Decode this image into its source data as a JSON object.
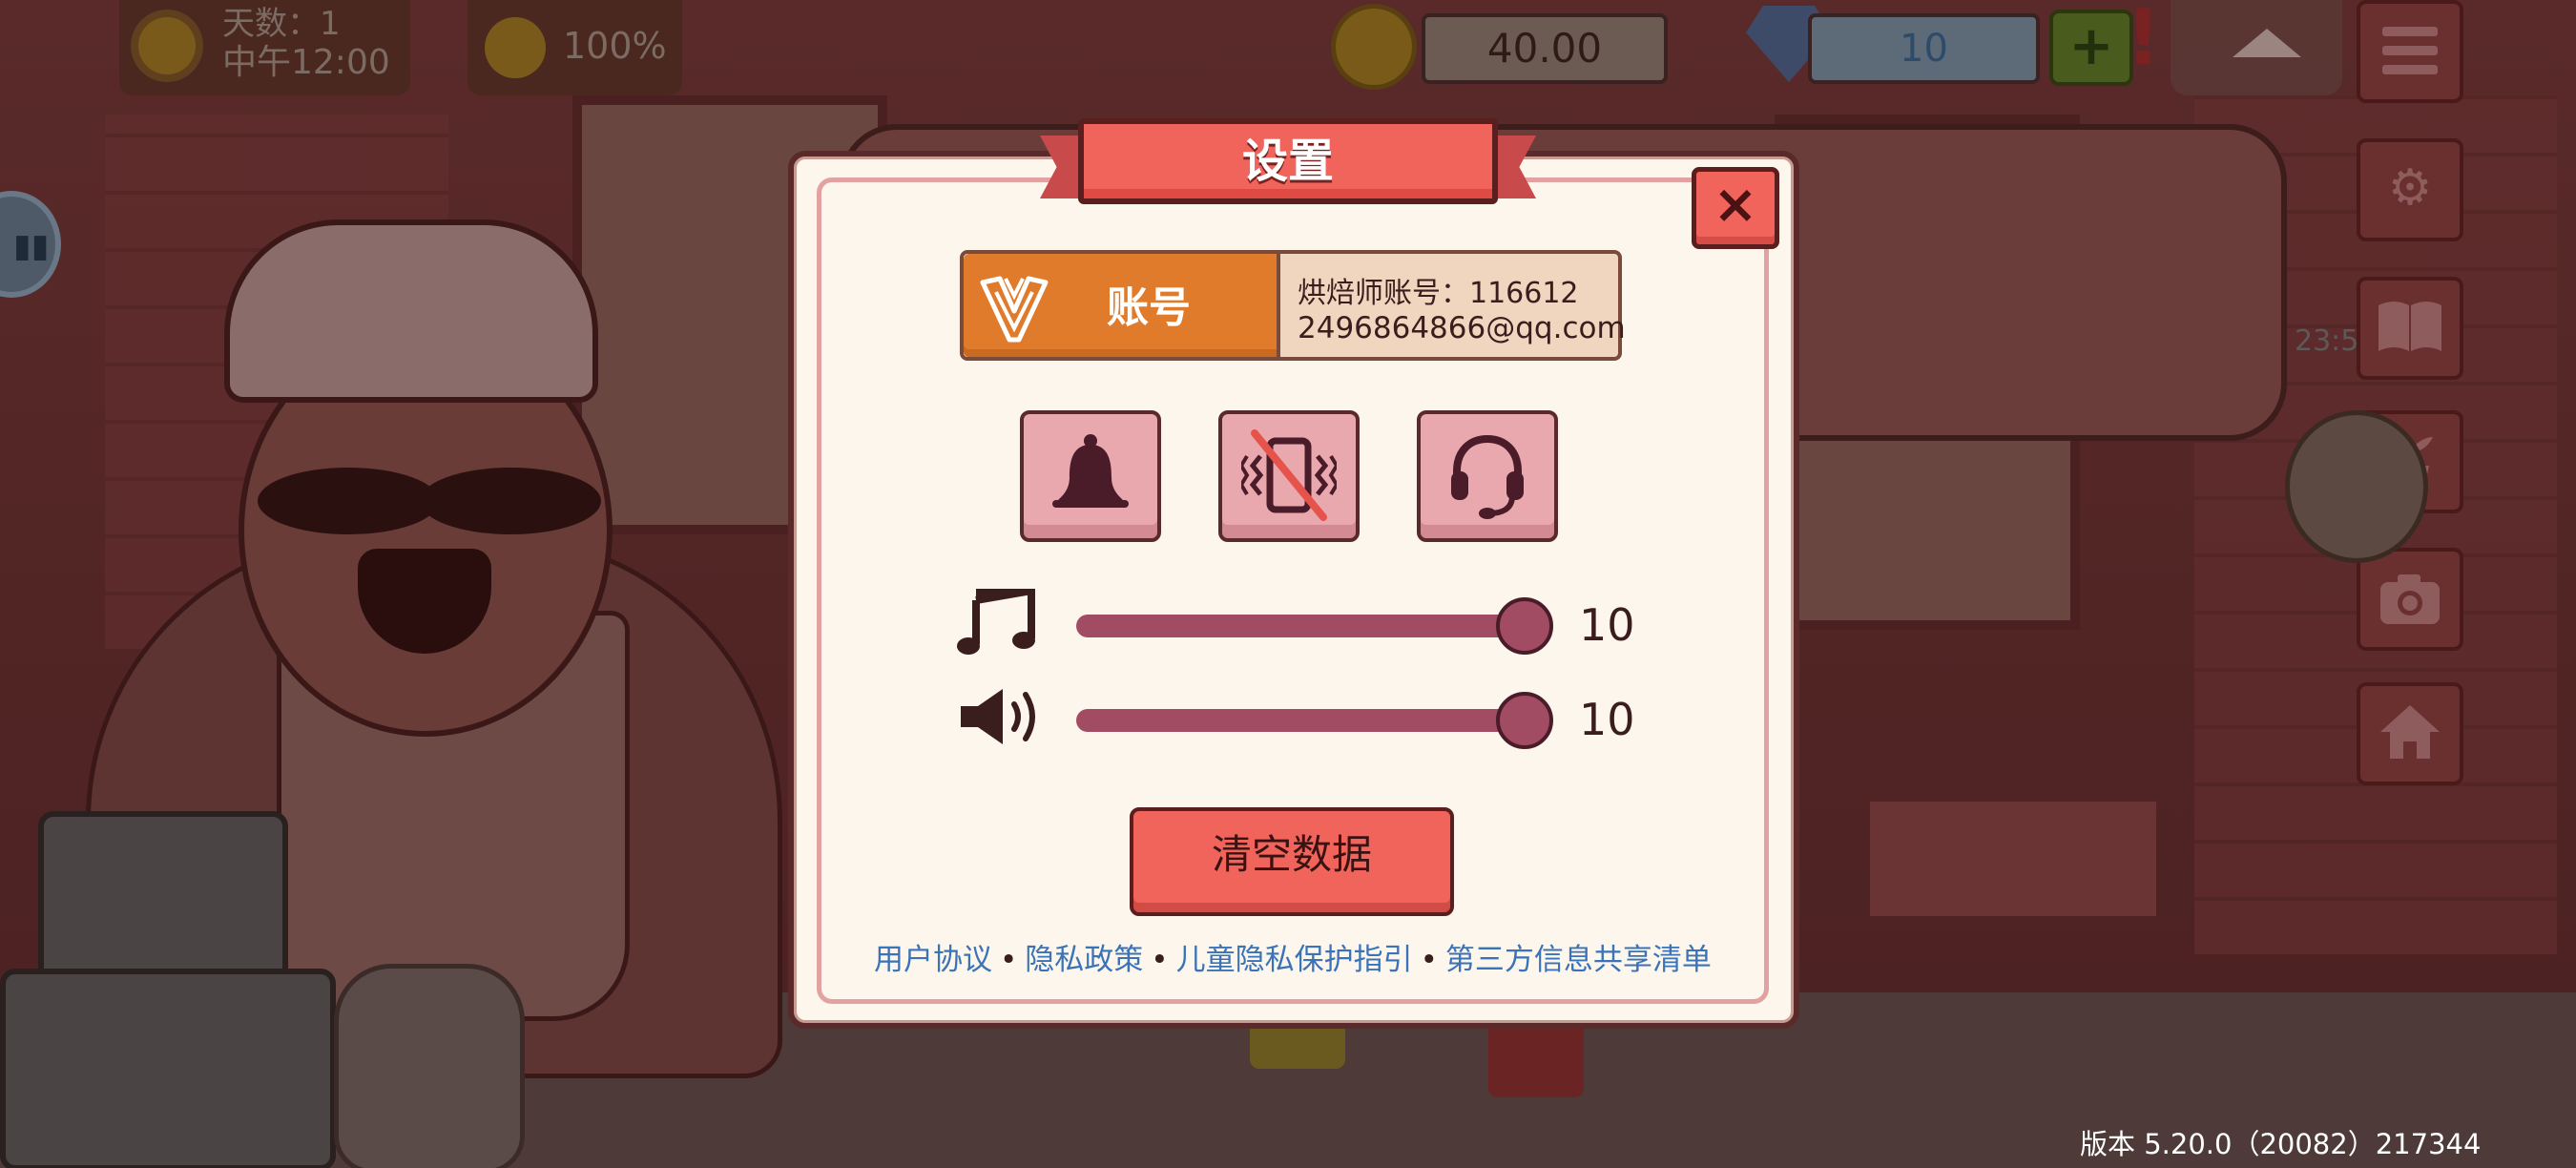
{
  "hud": {
    "day_label": "天数：1",
    "time_label": "中午12:00",
    "mood_percent": "100%",
    "coins": "40.00",
    "gems": "10",
    "add_label": "+",
    "alert_label": "!",
    "side_icons": [
      "menu-icon",
      "gear-icon",
      "book-icon",
      "plant-icon",
      "camera-icon",
      "home-icon"
    ],
    "timer_text": "23:5",
    "version_text": "版本 5.20.0（20082）217344"
  },
  "dialog": {
    "title": "设置",
    "close_label": "×",
    "account": {
      "button_label": "账号",
      "baker_id_line": "烘焙师账号：116612",
      "email_line": "2496864866@qq.com"
    },
    "toggles": [
      {
        "name": "notification",
        "icon": "bell-icon",
        "state": "on"
      },
      {
        "name": "vibration",
        "icon": "vibrate-off-icon",
        "state": "off"
      },
      {
        "name": "support",
        "icon": "headset-icon",
        "state": "on"
      }
    ],
    "music": {
      "icon": "music-note-icon",
      "value_label": "10",
      "level": 1.0
    },
    "sound": {
      "icon": "speaker-icon",
      "value_label": "10",
      "level": 1.0
    },
    "clear_button": "清空数据",
    "links": [
      "用户协议",
      "隐私政策",
      "儿童隐私保护指引",
      "第三方信息共享清单"
    ],
    "link_separator": "•"
  },
  "colors": {
    "accent_red": "#f0645b",
    "account_orange": "#e07b2c",
    "slider": "#a24c64",
    "link_blue": "#3a73b8",
    "panel_bg": "#fcf6ec"
  }
}
